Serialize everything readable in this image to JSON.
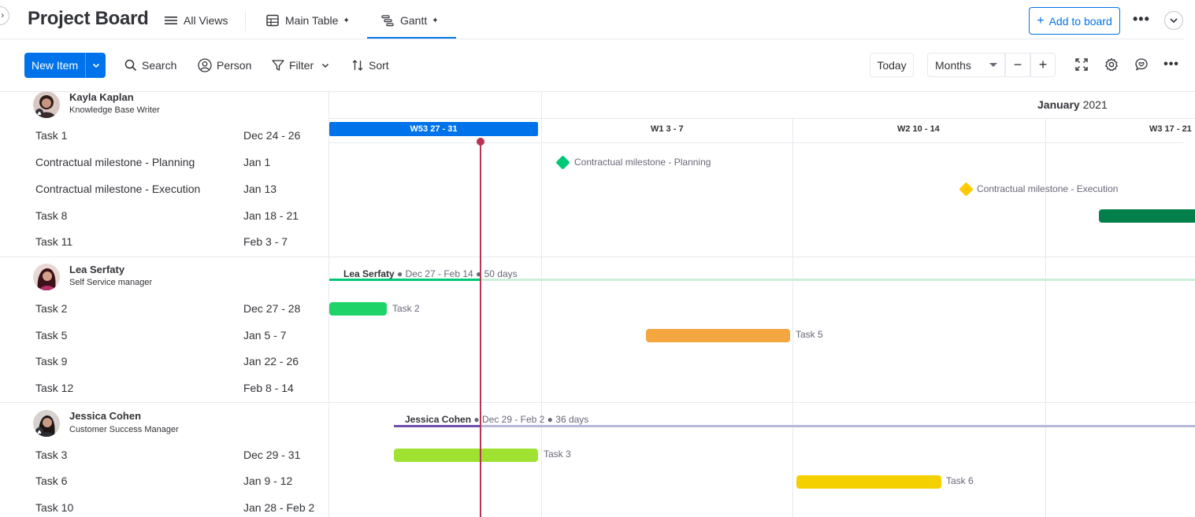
{
  "header": {
    "title": "Project Board",
    "tabs": [
      {
        "label": "All Views",
        "icon": "menu-icon"
      },
      {
        "label": "Main Table",
        "icon": "table-icon",
        "pinned": true
      },
      {
        "label": "Gantt",
        "icon": "gantt-icon",
        "pinned": true,
        "active": true
      }
    ],
    "add_to_board": "Add to board",
    "add_plus": "+"
  },
  "toolbar": {
    "new_item": "New Item",
    "search": "Search",
    "person": "Person",
    "filter": "Filter",
    "sort": "Sort",
    "today": "Today",
    "scale": "Months",
    "zoom_out": "−",
    "zoom_in": "+"
  },
  "timeline": {
    "month": "January",
    "year": "2021",
    "weeks": [
      {
        "label": "W53   27 - 31",
        "current": true
      },
      {
        "label": "W1   3 - 7"
      },
      {
        "label": "W2   10 - 14"
      },
      {
        "label": "W3   17 - 21"
      }
    ]
  },
  "groups": [
    {
      "owner": "Kayla Kaplan",
      "role": "Knowledge Base Writer",
      "tasks": [
        {
          "name": "Task 1",
          "dates": "Dec 24 - 26"
        },
        {
          "name": "Contractual milestone - Planning",
          "dates": "Jan 1"
        },
        {
          "name": "Contractual milestone - Execution",
          "dates": "Jan 13"
        },
        {
          "name": "Task 8",
          "dates": "Jan 18 - 21"
        },
        {
          "name": "Task 11",
          "dates": "Feb 3 - 7"
        }
      ],
      "gantt": {
        "milestones": [
          {
            "label": "Contractual milestone - Planning",
            "color": "#00c875"
          },
          {
            "label": "Contractual milestone - Execution",
            "color": "#ffcb00"
          }
        ],
        "task8_color": "#037f4c"
      }
    },
    {
      "owner": "Lea Serfaty",
      "role": "Self Service manager",
      "summary": {
        "name": "Lea Serfaty",
        "range": "● Dec 27 - Feb 14 ●",
        "days": "50 days"
      },
      "tasks": [
        {
          "name": "Task 2",
          "dates": "Dec 27 - 28"
        },
        {
          "name": "Task 5",
          "dates": "Jan 5 - 7"
        },
        {
          "name": "Task 9",
          "dates": "Jan 22 - 26"
        },
        {
          "name": "Task 12",
          "dates": "Feb 8 - 14"
        }
      ],
      "gantt": {
        "bars": [
          {
            "label": "Task 2",
            "color": "#1ed468"
          },
          {
            "label": "Task 5",
            "color": "#f4a640"
          }
        ]
      }
    },
    {
      "owner": "Jessica Cohen",
      "role": "Customer Success Manager",
      "summary": {
        "name": "Jessica Cohen",
        "range": "● Dec 29 - Feb 2 ●",
        "days": "36 days"
      },
      "tasks": [
        {
          "name": "Task 3",
          "dates": "Dec 29 - 31"
        },
        {
          "name": "Task 6",
          "dates": "Jan 9 - 12"
        },
        {
          "name": "Task 10",
          "dates": "Jan 28 - Feb 2"
        }
      ],
      "gantt": {
        "bars": [
          {
            "label": "Task 3",
            "color": "#9fe231"
          },
          {
            "label": "Task 6",
            "color": "#f5d000"
          }
        ]
      }
    }
  ],
  "colors": {
    "accent": "#0073ea",
    "today_line": "#bb3354",
    "lea_track": "#caf0d8",
    "jessica_track": "#b8b9d9"
  }
}
